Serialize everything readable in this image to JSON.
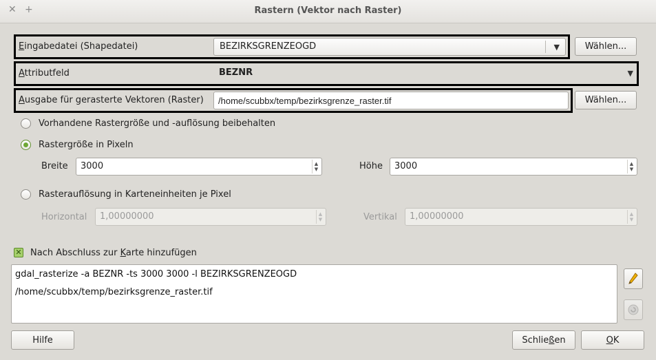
{
  "window": {
    "title": "Rastern (Vektor nach Raster)",
    "close_glyph": "✕",
    "add_glyph": "+"
  },
  "input_file": {
    "label_first": "E",
    "label_rest": "ingabedatei (Shapedatei)",
    "value": "BEZIRKSGRENZEOGD",
    "browse_label": "Wählen..."
  },
  "attribute": {
    "label_first": "A",
    "label_rest": "ttributfeld",
    "value": "BEZNR"
  },
  "output": {
    "label_first": "A",
    "label_rest": "usgabe für gerasterte Vektoren (Raster)",
    "value": "/home/scubbx/temp/bezirksgrenze_raster.tif",
    "browse_label": "Wählen..."
  },
  "options": {
    "keep_size_label": "Vorhandene Rastergröße und -auflösung beibehalten",
    "pixel_size_label": "Rastergröße in Pixeln",
    "width_label": "Breite",
    "width_value": "3000",
    "height_label": "Höhe",
    "height_value": "3000",
    "map_units_label": "Rasterauflösung in Karteneinheiten je Pixel",
    "horizontal_label": "Horizontal",
    "horizontal_value": "1,00000000",
    "vertical_label": "Vertikal",
    "vertical_value": "1,00000000",
    "selected": "pixel_size"
  },
  "add_to_map": {
    "label_before": "Nach Abschluss zur ",
    "label_key": "K",
    "label_after": "arte hinzufügen",
    "checked": true,
    "check_glyph": "✕"
  },
  "command": {
    "line1": "gdal_rasterize -a BEZNR -ts 3000 3000 -l BEZIRKSGRENZEOGD",
    "line2": "/home/scubbx/temp/bezirksgrenze_raster.tif"
  },
  "buttons": {
    "help": "Hilfe",
    "close_before": "Schlie",
    "close_key": "ß",
    "close_after": "en",
    "ok_key": "O",
    "ok_after": "K"
  },
  "icons": {
    "edit": "pencil-icon",
    "reset": "reset-icon"
  },
  "colors": {
    "accent": "#6ea835",
    "highlight_border": "#000000"
  }
}
